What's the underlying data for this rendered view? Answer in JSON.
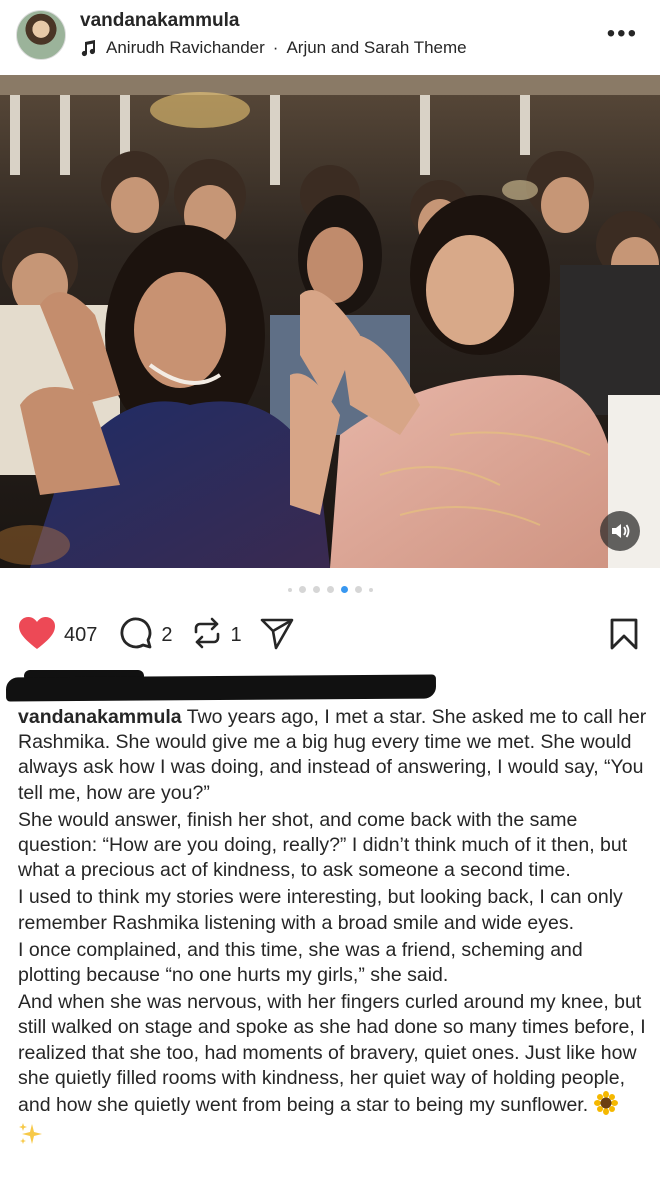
{
  "post": {
    "username": "vandanakammula",
    "music": {
      "artist": "Anirudh Ravichander",
      "separator": "·",
      "track": "Arjun and Sarah Theme"
    },
    "more_label": "•••"
  },
  "carousel": {
    "total_slides": 7,
    "active_index": 4
  },
  "actions": {
    "likes": "407",
    "comments": "2",
    "reposts": "1"
  },
  "colors": {
    "like_red": "#ed4956",
    "active_dot": "#3897f0",
    "text": "#262626"
  },
  "caption": {
    "username": "vandanakammula",
    "paragraphs": [
      "Two years ago, I met a star. She asked me to call her Rashmika. She would give me a big hug every time we met. She would always ask how I was doing, and instead of answering, I would say, “You tell me, how are you?”",
      "She would answer, finish her shot, and come back with the same question: “How are you doing, really?” I didn’t think much of it then, but what a precious act of kindness, to ask someone a second time.",
      "I used to think my stories were interesting, but looking back, I can only remember Rashmika listening with a broad smile and wide eyes.",
      "I once complained, and this time, she was a friend, scheming and plotting because “no one hurts my girls,” she said.",
      "And when she was nervous, with her fingers curled around my knee, but still walked on stage and spoke as she had done so many times before, I realized that she too, had moments of bravery, quiet ones. Just like how she quietly filled rooms with kindness, her quiet way of holding people, and how she quietly went from being a star to being my sunflower."
    ],
    "emojis": [
      "sunflower-emoji",
      "sparkles-emoji"
    ]
  }
}
